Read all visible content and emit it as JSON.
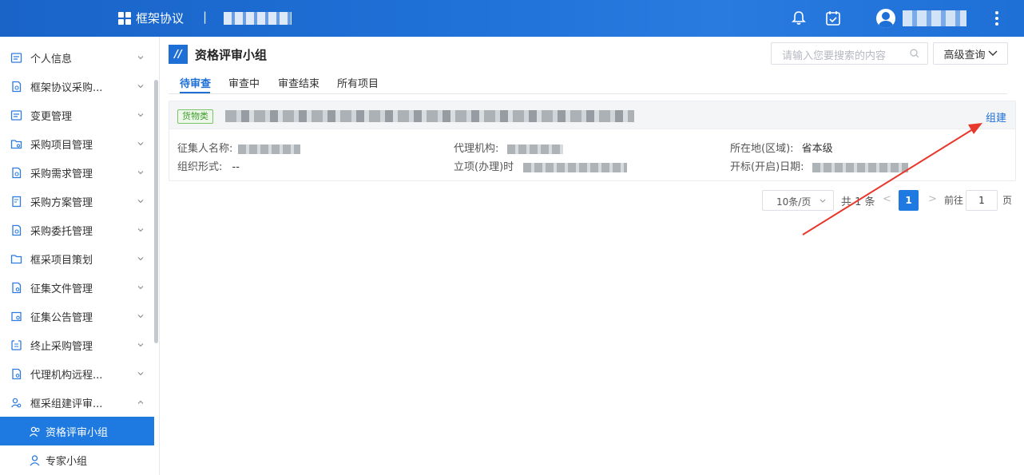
{
  "header": {
    "app_title": "框架协议",
    "separator": "|",
    "icons": [
      "bell-icon",
      "calendar-check-icon",
      "user-avatar-icon",
      "more-vertical-icon"
    ]
  },
  "sidebar": {
    "items": [
      {
        "label": "个人信息",
        "icon": "id-card-icon",
        "expanded": false
      },
      {
        "label": "框架协议采购...",
        "icon": "document-search-icon",
        "expanded": false
      },
      {
        "label": "变更管理",
        "icon": "id-card-icon",
        "expanded": false
      },
      {
        "label": "采购项目管理",
        "icon": "folder-gear-icon",
        "expanded": false
      },
      {
        "label": "采购需求管理",
        "icon": "document-search-icon",
        "expanded": false
      },
      {
        "label": "采购方案管理",
        "icon": "document-edit-icon",
        "expanded": false
      },
      {
        "label": "采购委托管理",
        "icon": "document-search-icon",
        "expanded": false
      },
      {
        "label": "框采项目策划",
        "icon": "folder-icon",
        "expanded": false
      },
      {
        "label": "征集文件管理",
        "icon": "document-gear-icon",
        "expanded": false
      },
      {
        "label": "征集公告管理",
        "icon": "notice-gear-icon",
        "expanded": false
      },
      {
        "label": "终止采购管理",
        "icon": "stop-doc-icon",
        "expanded": false
      },
      {
        "label": "代理机构远程...",
        "icon": "document-gear-icon",
        "expanded": false
      },
      {
        "label": "框采组建评审...",
        "icon": "user-group-icon",
        "expanded": true
      }
    ],
    "sub_items": [
      {
        "label": "资格评审小组",
        "icon": "users-icon",
        "active": true
      },
      {
        "label": "专家小组",
        "icon": "user-icon",
        "active": false
      }
    ]
  },
  "page": {
    "title": "资格评审小组",
    "search_placeholder": "请输入您要搜索的内容",
    "advanced_query": "高级查询",
    "tabs": [
      "待审查",
      "审查中",
      "审查结束",
      "所有项目"
    ],
    "active_tab": 0
  },
  "card": {
    "tag": "货物类",
    "action": "组建",
    "fields": {
      "collector_label": "征集人名称:",
      "agency_label": "代理机构:",
      "region_label": "所在地(区域):",
      "region_value": "省本级",
      "org_form_label": "组织形式:",
      "org_form_value": "--",
      "project_time_label": "立项(办理)时",
      "open_date_label": "开标(开启)日期:"
    }
  },
  "pagination": {
    "page_size": "10条/页",
    "total": "共 1 条",
    "current": "1",
    "goto_label": "前往",
    "goto_value": "1",
    "page_suffix": "页",
    "prev": "<",
    "next": ">"
  },
  "colors": {
    "primary": "#1e6fd6",
    "tag_green": "#3d9d2b",
    "annotation_arrow": "#e8382b"
  }
}
